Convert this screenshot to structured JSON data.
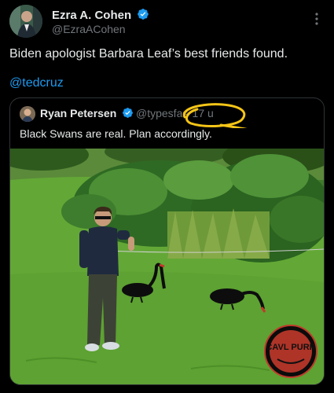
{
  "post": {
    "author_name": "Ezra A. Cohen",
    "author_handle": "@EzraACohen",
    "text": "Biden apologist Barbara Leaf’s best friends found.",
    "mention": "@tedcruz"
  },
  "quote": {
    "author_name": "Ryan Petersen",
    "author_handle": "@typesfas",
    "time": "· 17 u",
    "text": "Black Swans are real. Plan accordingly."
  },
  "photo": {
    "watermark": "CAVL PURR"
  },
  "icons": {
    "verified": "verified-badge-icon",
    "more": "more-horizontal-icon"
  },
  "colors": {
    "background": "#000000",
    "text": "#e7e9ea",
    "secondary": "#71767b",
    "link": "#1d9bf0",
    "verified": "#1d9bf0",
    "annotation": "#f5c518"
  }
}
